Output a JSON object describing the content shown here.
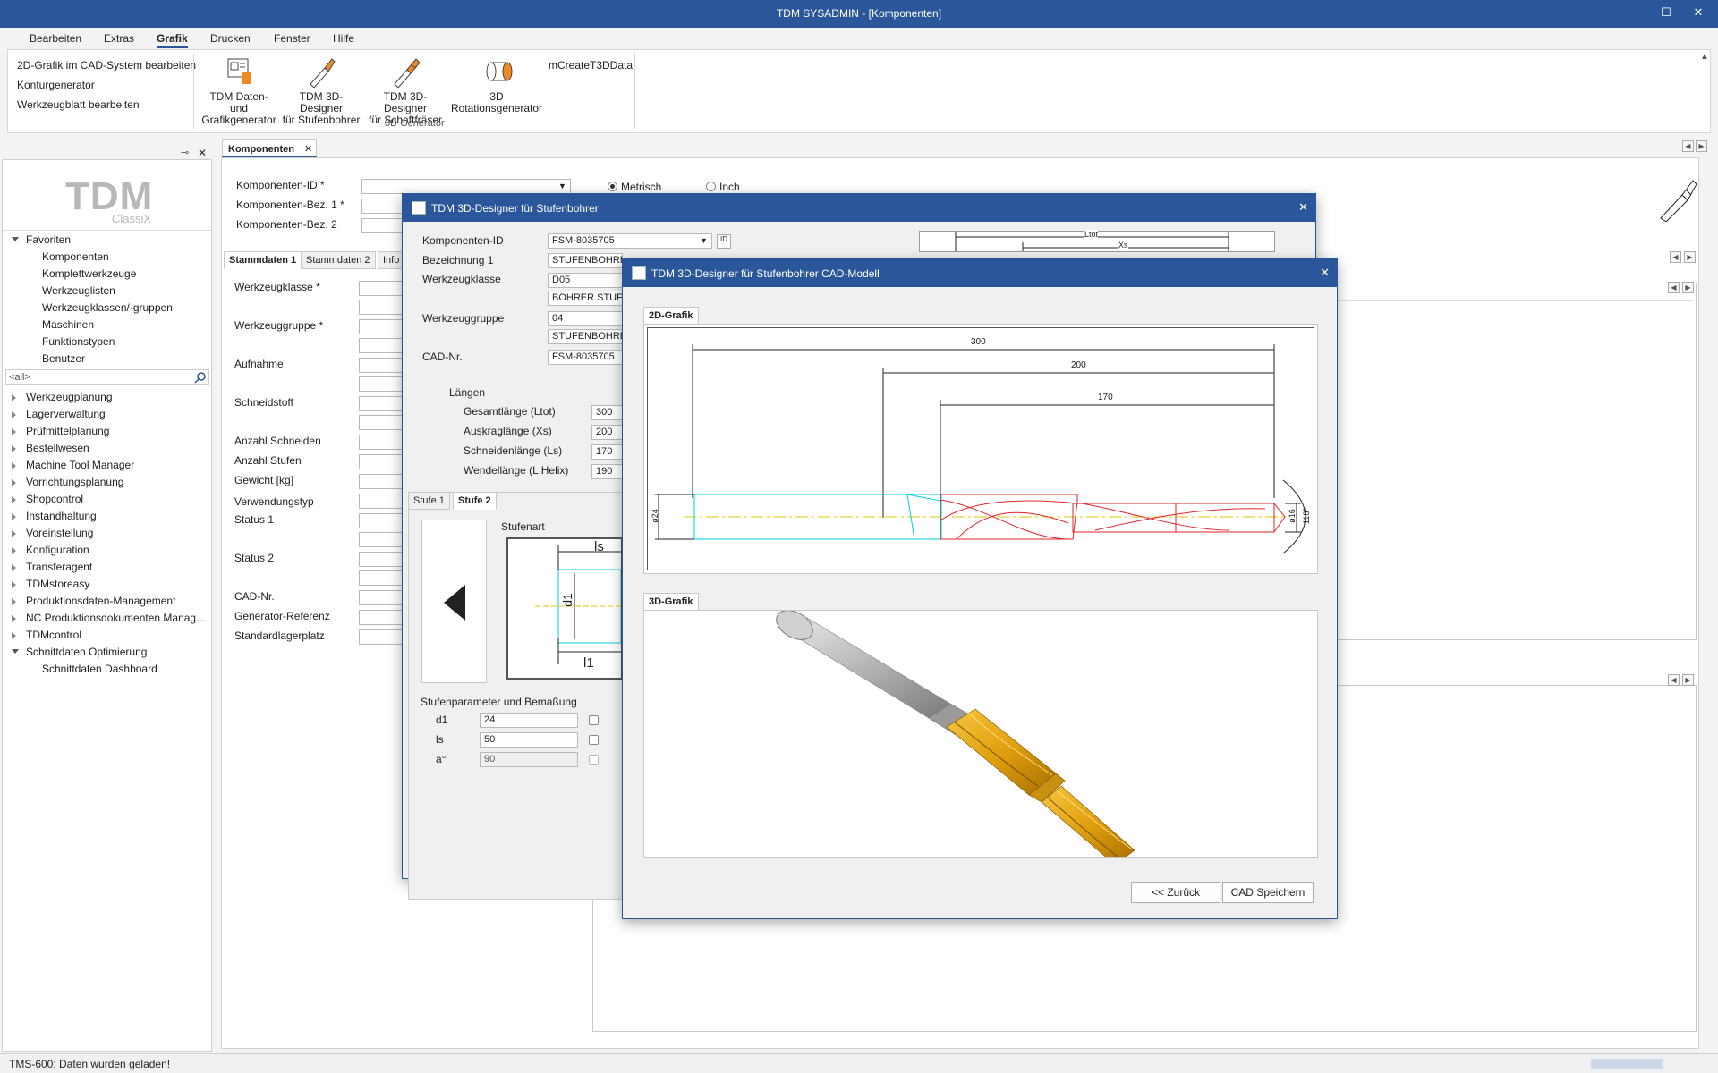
{
  "window": {
    "title": "TDM SYSADMIN - [Komponenten]",
    "minimize": "—",
    "maximize": "☐",
    "close": "✕"
  },
  "menu": [
    "Bearbeiten",
    "Extras",
    "Grafik",
    "Drucken",
    "Fenster",
    "Hilfe"
  ],
  "ribbon": {
    "links": [
      "2D-Grafik im CAD-System bearbeiten",
      "Konturgenerator",
      "Werkzeugblatt bearbeiten"
    ],
    "buttons": [
      {
        "line1": "TDM Daten- und",
        "line2": "Grafikgenerator"
      },
      {
        "line1": "TDM 3D-Designer",
        "line2": "für Stufenbohrer"
      },
      {
        "line1": "TDM 3D-Designer",
        "line2": "für Schaftfräser"
      },
      {
        "line1": "3D",
        "line2": "Rotationsgenerator"
      }
    ],
    "extra": "mCreateT3DData",
    "group": "3D Generator"
  },
  "doctab": {
    "label": "Komponenten",
    "close": "✕"
  },
  "panel": {
    "pin": "⊸",
    "close": "✕"
  },
  "logo": {
    "main": "TDM",
    "sub": "ClassiX"
  },
  "tree": {
    "favoriten": "Favoriten",
    "fav_items": [
      "Komponenten",
      "Komplettwerkzeuge",
      "Werkzeuglisten",
      "Werkzeugklassen/-gruppen",
      "Maschinen",
      "Funktionstypen",
      "Benutzer"
    ],
    "search": "<all>",
    "modules": [
      "Werkzeugplanung",
      "Lagerverwaltung",
      "Prüfmittelplanung",
      "Bestellwesen",
      "Machine Tool Manager",
      "Vorrichtungsplanung",
      "Shopcontrol",
      "Instandhaltung",
      "Voreinstellung",
      "Konfiguration",
      "Transferagent",
      "TDMstoreasy",
      "Produktionsdaten-Management",
      "NC Produktionsdokumenten Manag...",
      "TDMcontrol",
      "Schnittdaten Optimierung"
    ],
    "sub": "Schnittdaten Dashboard"
  },
  "form": {
    "id_label": "Komponenten-ID *",
    "bez1_label": "Komponenten-Bez. 1 *",
    "bez2_label": "Komponenten-Bez. 2",
    "metric": "Metrisch",
    "inch": "Inch",
    "tabs": [
      "Stammdaten 1",
      "Stammdaten 2",
      "Info"
    ],
    "fields": [
      "Werkzeugklasse *",
      "Werkzeuggruppe *",
      "Aufnahme",
      "Schneidstoff",
      "Anzahl Schneiden",
      "Anzahl Stufen",
      "Gewicht [kg]",
      "Verwendungstyp",
      "Status 1",
      "Status 2",
      "CAD-Nr.",
      "Generator-Referenz",
      "Standardlagerplatz"
    ]
  },
  "dlg1": {
    "title": "TDM 3D-Designer für Stufenbohrer",
    "close": "✕",
    "id_label": "Komponenten-ID",
    "id_value": "FSM-8035705",
    "bez_label": "Bezeichnung 1",
    "bez_value": "STUFENBOHRER",
    "wk_label": "Werkzeugklasse",
    "wk_code": "D05",
    "wk_name": "BOHRER STUFE",
    "wg_label": "Werkzeuggruppe",
    "wg_code": "04",
    "wg_name": "STUFENBOHRER",
    "cad_label": "CAD-Nr.",
    "cad_value": "FSM-8035705",
    "laengen": "Längen",
    "lengths": [
      {
        "label": "Gesamtlänge (Ltot)",
        "value": "300"
      },
      {
        "label": "Auskraglänge (Xs)",
        "value": "200"
      },
      {
        "label": "Schneidenlänge (Ls)",
        "value": "170"
      },
      {
        "label": "Wendellänge (L Helix)",
        "value": "190"
      }
    ],
    "stufe_tabs": [
      "Stufe 1",
      "Stufe 2"
    ],
    "stufenart": "Stufenart",
    "preview_labels": {
      "ltot": "Ltot",
      "xs": "Xs",
      "ls": "ls",
      "d1": "d1",
      "l1": "l1"
    },
    "params_title": "Stufenparameter und Bemaßung",
    "params": [
      {
        "label": "d1",
        "value": "24"
      },
      {
        "label": "ls",
        "value": "50"
      },
      {
        "label": "a°",
        "value": "90"
      }
    ]
  },
  "dlg2": {
    "title": "TDM 3D-Designer für Stufenbohrer CAD-Modell",
    "close": "✕",
    "tab2d": "2D-Grafik",
    "tab3d": "3D-Grafik",
    "dims": {
      "d300": "300",
      "d200": "200",
      "d170": "170",
      "dia24": "ø24",
      "dia16": "ø16",
      "angle": "118°"
    },
    "back": "<< Zurück",
    "save": "CAD Speichern"
  },
  "status": "TMS-600: Daten wurden geladen!",
  "colors": {
    "accent": "#2b579a",
    "shank": "#00cfe0",
    "cutting": "#e0242a",
    "gold": "#f0b020"
  }
}
